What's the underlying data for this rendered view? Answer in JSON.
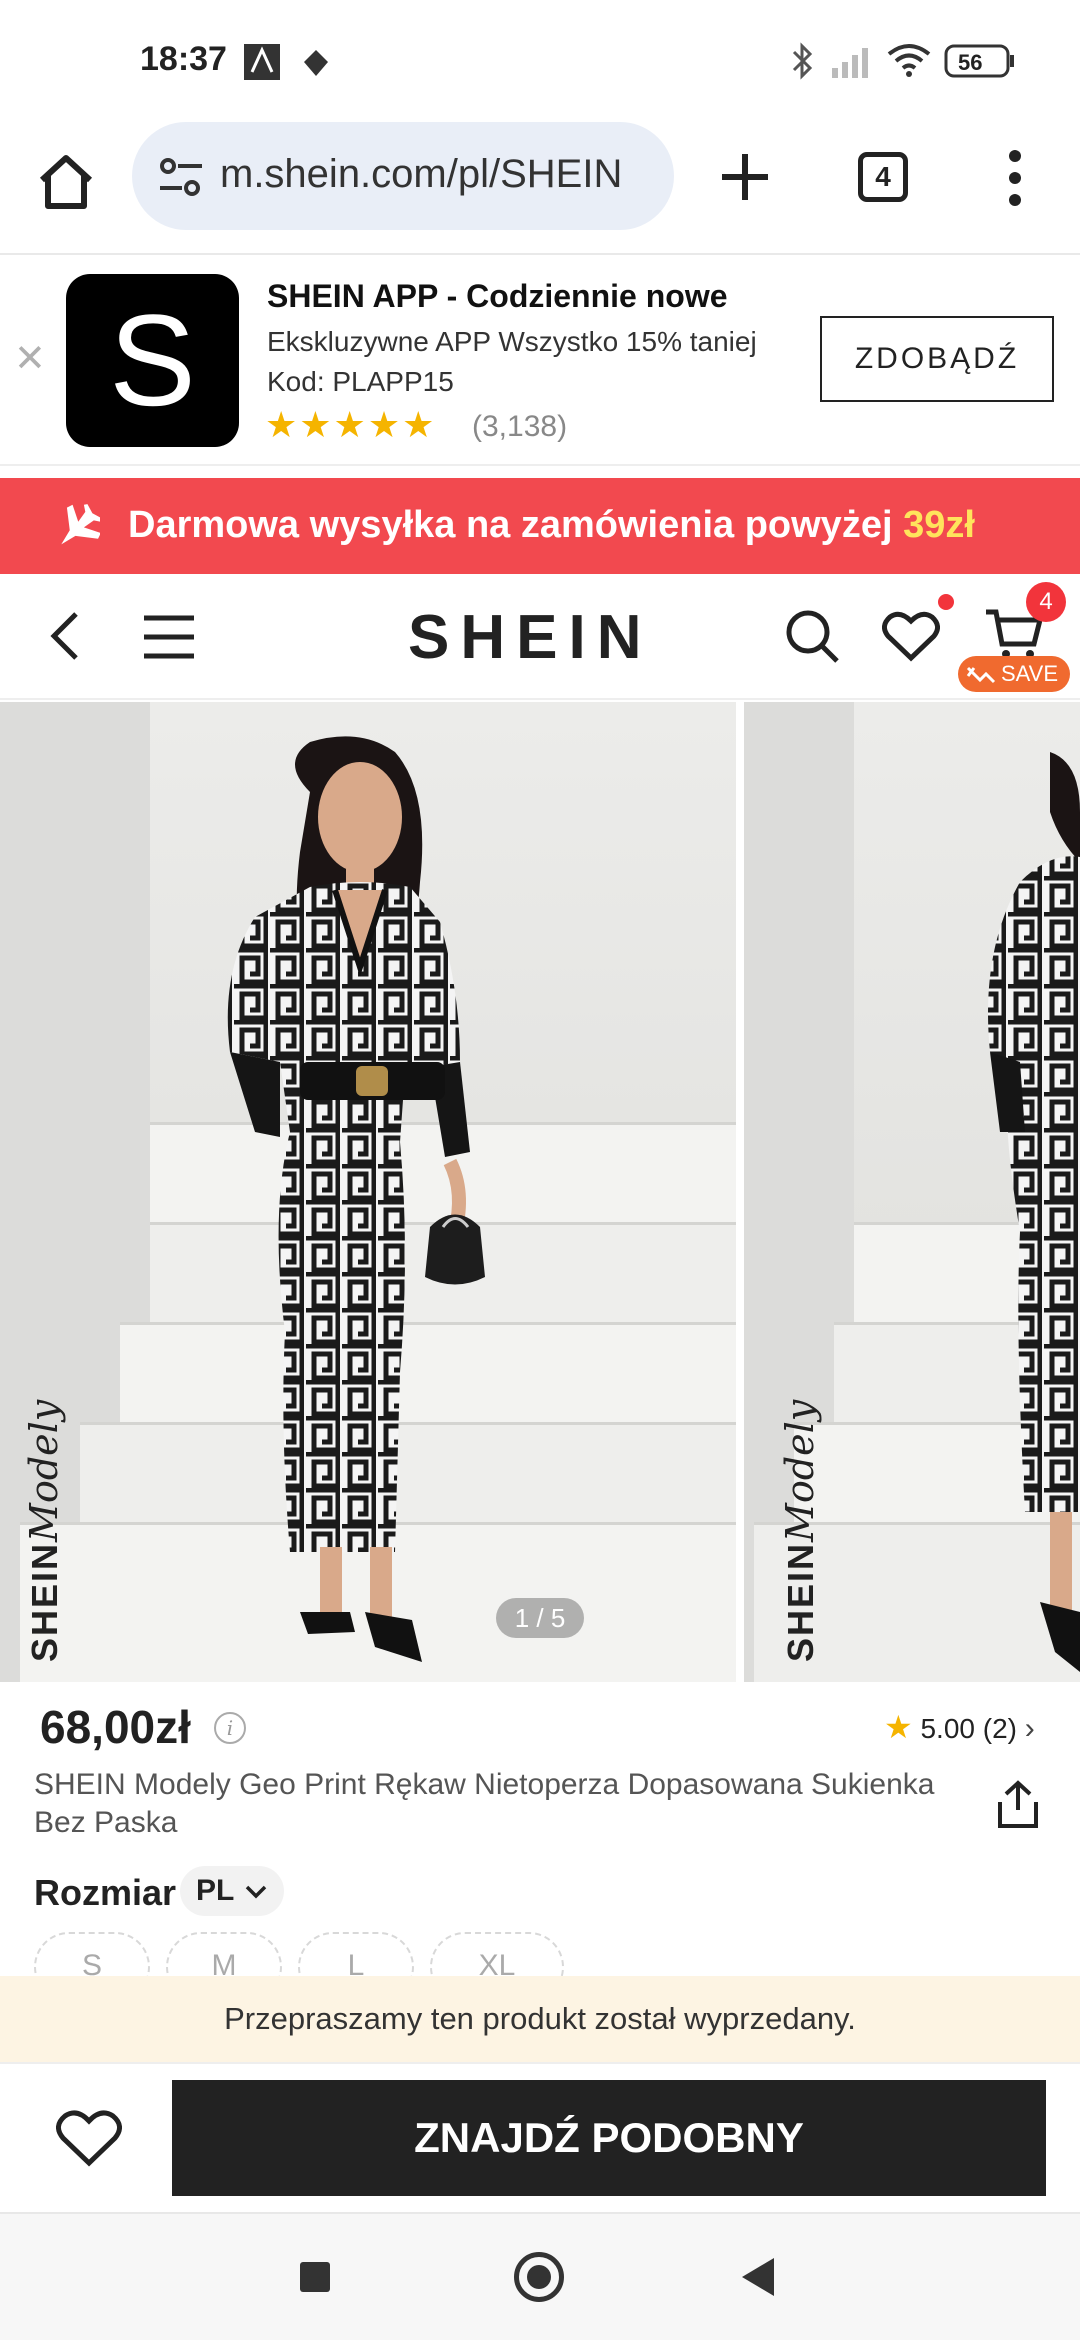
{
  "status_bar": {
    "time": "18:37",
    "battery": "56",
    "icons": [
      "notification-app-icon",
      "notification-app-icon-2",
      "bluetooth-icon",
      "signal-icon",
      "wifi-icon",
      "battery-icon"
    ]
  },
  "browser": {
    "url": "m.shein.com/pl/SHEIN",
    "tab_count": "4",
    "icons": [
      "home-icon",
      "site-settings-icon",
      "new-tab-plus-icon",
      "tab-switcher-icon",
      "overflow-menu-icon"
    ]
  },
  "app_banner": {
    "logo_letter": "S",
    "title": "SHEIN APP - Codziennie nowe",
    "line2": "Ekskluzywne APP Wszystko 15% taniej",
    "line3": "Kod: PLAPP15",
    "stars": "★★★★★",
    "rating_count": "(3,138)",
    "button": "ZDOBĄDŹ"
  },
  "shipping_banner": {
    "text": "Darmowa wysyłka na zamówienia powyżej ",
    "amount": "39zł",
    "color": "#f2494f"
  },
  "header": {
    "logo": "SHEIN",
    "cart_count": "4",
    "save_label": "SAVE"
  },
  "gallery": {
    "watermark_brand": "SHEIN",
    "watermark_script": "Modely",
    "counter": "1 / 5"
  },
  "product": {
    "price": "68,00zł",
    "info_icon": "i",
    "rating": "5.00 (2)",
    "title": "SHEIN Modely Geo Print Rękaw Nietoperza Dopasowana Sukienka Bez Paska",
    "size_label": "Rozmiar",
    "size_system": "PL",
    "sizes": [
      "S",
      "M",
      "L",
      "XL"
    ]
  },
  "soldout_message": "Przepraszamy ten produkt został wyprzedany.",
  "action_bar": {
    "find_similar": "ZNAJDŹ PODOBNY"
  },
  "colors": {
    "accent_red": "#f2494f",
    "badge_red": "#f2343b",
    "save_orange": "#f06a2f",
    "star_yellow": "#f5b400",
    "soldout_bg": "#fdf4e3"
  }
}
